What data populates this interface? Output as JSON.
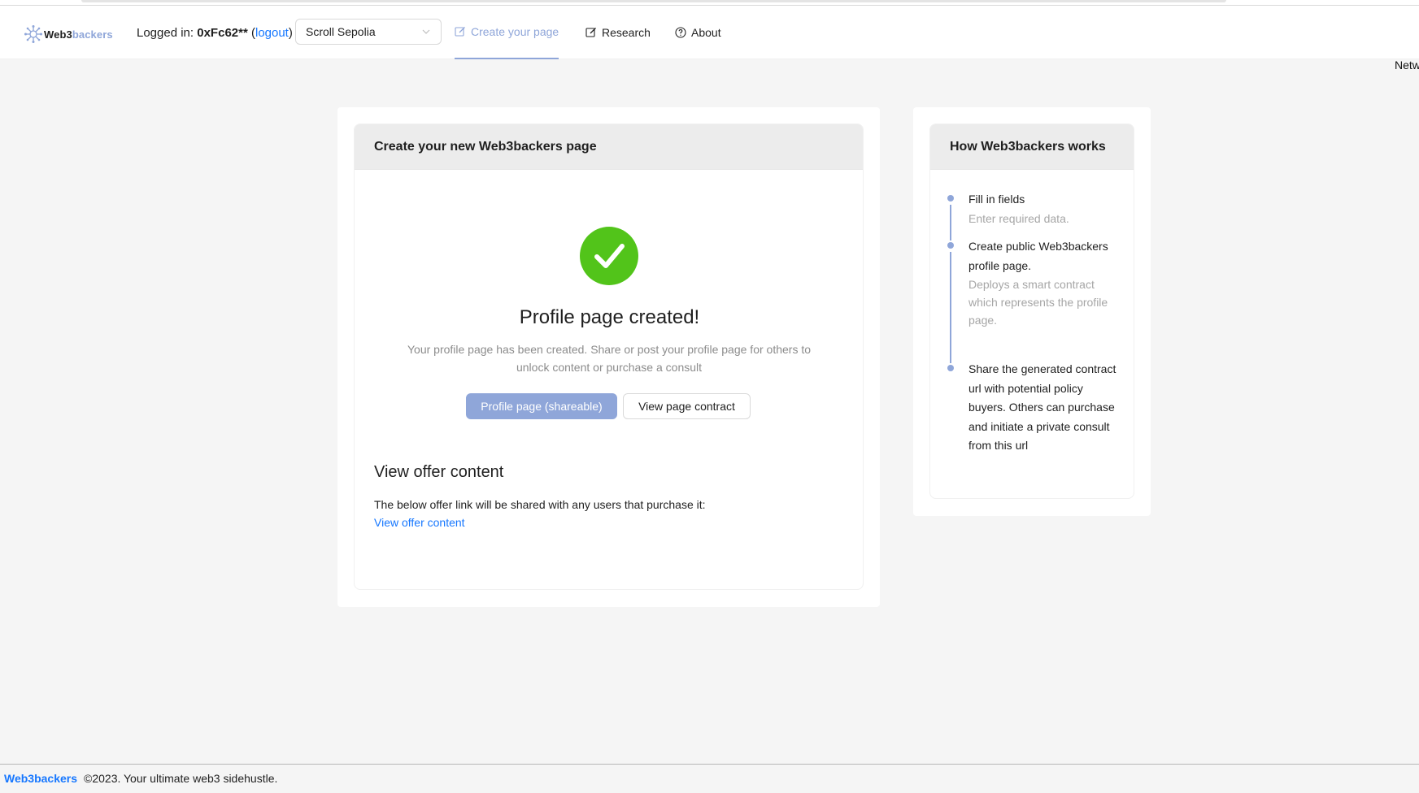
{
  "header": {
    "logo": {
      "web3": "Web3",
      "backers": "backers"
    },
    "login": {
      "prefix": "Logged in:",
      "address": "0xFc62**",
      "logout": "logout"
    },
    "network": {
      "selected": "Scroll Sepolia"
    },
    "nav": [
      {
        "label": "Create your page",
        "icon": "edit-icon",
        "active": true
      },
      {
        "label": "Research",
        "icon": "edit-icon",
        "active": false
      },
      {
        "label": "About",
        "icon": "question-circle-icon",
        "active": false
      }
    ],
    "clipped_right_text": "Netw"
  },
  "main_card": {
    "title": "Create your new Web3backers page",
    "result": {
      "icon": "check-circle-icon",
      "title": "Profile page created!",
      "subtitle": "Your profile page has been created. Share or post your profile page for others to unlock content or purchase a consult",
      "primary_button": "Profile page (shareable)",
      "secondary_button": "View page contract"
    },
    "offer": {
      "heading": "View offer content",
      "description": "The below offer link will be shared with any users that purchase it:",
      "link_text": "View offer content"
    }
  },
  "side_card": {
    "title": "How Web3backers works",
    "steps": [
      {
        "title": "Fill in fields",
        "desc": "Enter required data."
      },
      {
        "title": "Create public Web3backers profile page.",
        "desc": "Deploys a smart contract which represents the profile page."
      },
      {
        "title": "Share the generated contract url with potential policy buyers. Others can purchase and initiate a private consult from this url",
        "desc": ""
      }
    ]
  },
  "footer": {
    "brand": "Web3backers",
    "text": "©2023. Your ultimate web3 sidehustle."
  },
  "colors": {
    "accent": "#8fa6d9",
    "link": "#1677ff",
    "success": "#52c41a",
    "background": "#f5f5f5"
  }
}
